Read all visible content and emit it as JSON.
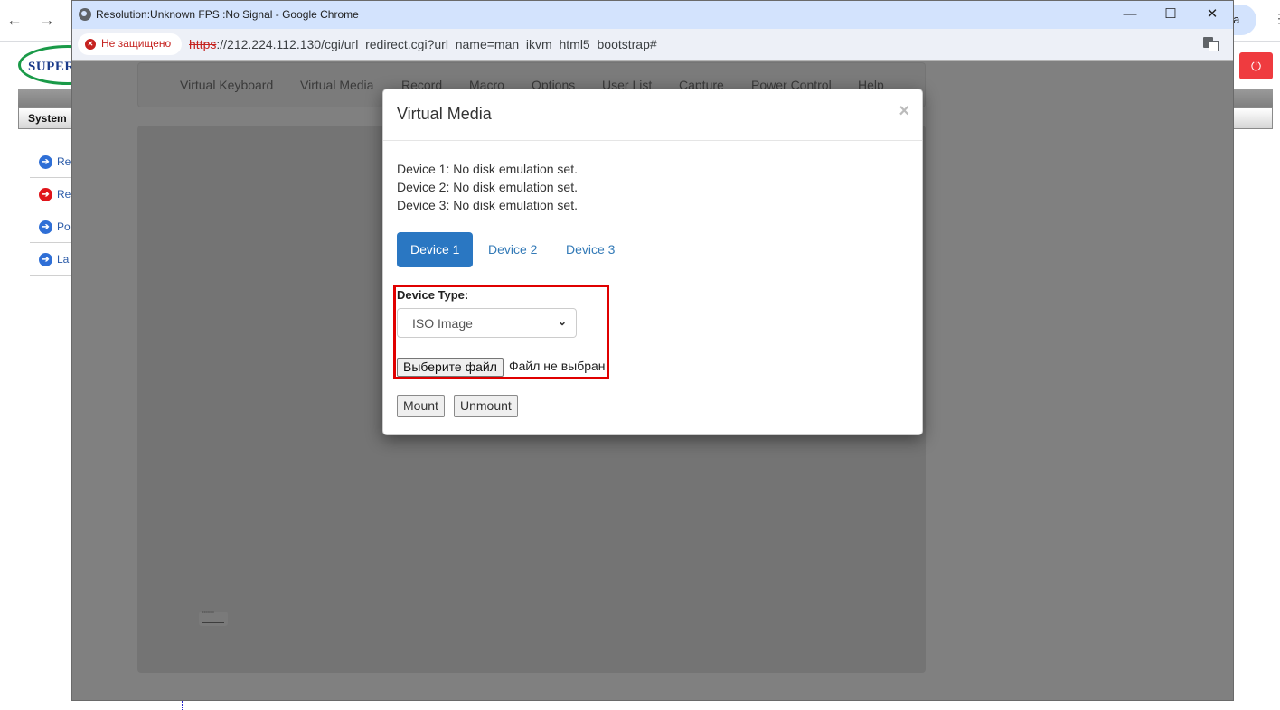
{
  "background_browser": {
    "back_icon": "←",
    "forward_icon": "→",
    "profile_text": "на",
    "menu_icon": "⋮"
  },
  "supermicro_page": {
    "logo_text": "SUPERM",
    "tab_system": "System",
    "power_icon": "⏻",
    "sidebar": [
      {
        "label": "Re",
        "icon_color": "#2f6fd6"
      },
      {
        "label": "Re",
        "icon_color": "#e0141a"
      },
      {
        "label": "Po",
        "icon_color": "#2f6fd6"
      },
      {
        "label": "La",
        "icon_color": "#2f6fd6"
      }
    ]
  },
  "popup_window": {
    "title": "Resolution:Unknown FPS :No Signal - Google Chrome",
    "controls": {
      "minimize": "—",
      "maximize": "☐",
      "close": "✕"
    },
    "security_label": "Не защищено",
    "url_scheme": "https",
    "url_rest": "://212.224.112.130/cgi/url_redirect.cgi?url_name=man_ikvm_html5_bootstrap#"
  },
  "kvm": {
    "menu": [
      "Virtual Keyboard",
      "Virtual Media",
      "Record",
      "Macro",
      "Options",
      "User List",
      "Capture",
      "Power Control",
      "Help"
    ]
  },
  "modal": {
    "title": "Virtual Media",
    "close_icon": "×",
    "status_lines": [
      "Device 1: No disk emulation set.",
      "Device 2: No disk emulation set.",
      "Device 3: No disk emulation set."
    ],
    "tabs": [
      {
        "label": "Device 1",
        "active": true
      },
      {
        "label": "Device 2",
        "active": false
      },
      {
        "label": "Device 3",
        "active": false
      }
    ],
    "device_type_label": "Device Type:",
    "device_type_value": "ISO Image",
    "choose_file_label": "Выберите файл",
    "file_status": "Файл не выбран",
    "mount_label": "Mount",
    "unmount_label": "Unmount",
    "highlight_color": "#e00000",
    "active_tab_color": "#2a77c2"
  }
}
